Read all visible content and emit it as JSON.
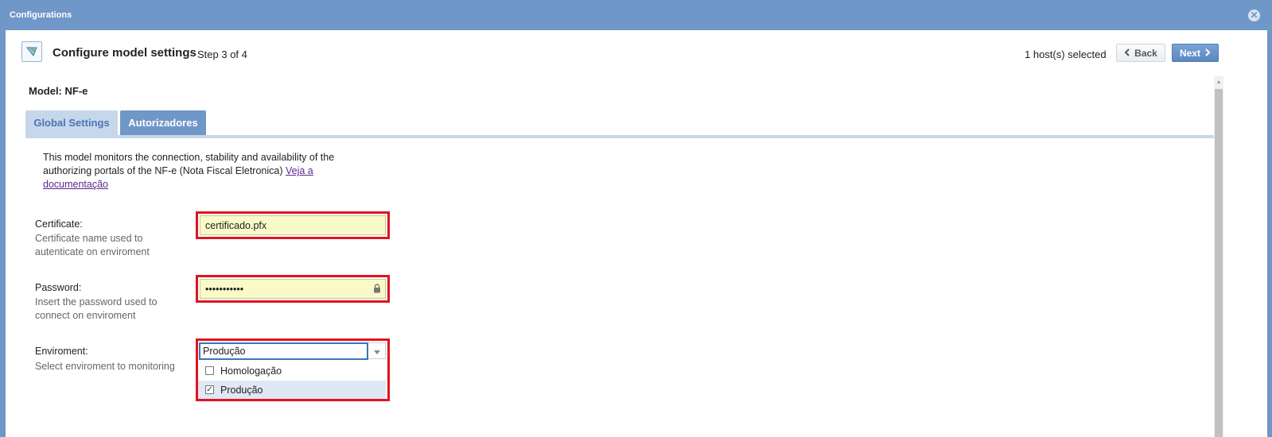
{
  "window": {
    "title": "Configurations"
  },
  "header": {
    "title": "Configure model settings",
    "step": "Step 3 of 4",
    "hosts_selected": "1 host(s) selected",
    "back_label": "Back",
    "next_label": "Next"
  },
  "model": {
    "label": "Model: NF-e"
  },
  "tabs": [
    {
      "label": "Global Settings"
    },
    {
      "label": "Autorizadores"
    }
  ],
  "description": {
    "text": "This model monitors the connection, stability and availability of the authorizing portals of the NF-e (Nota Fiscal Eletronica) ",
    "link": "Veja a documentação"
  },
  "fields": {
    "certificate": {
      "label": "Certificate:",
      "help": "Certificate name used to autenticate on enviroment",
      "value": "certificado.pfx"
    },
    "password": {
      "label": "Password:",
      "help": "Insert the password used to connect on enviroment",
      "value": "•••••••••••"
    },
    "environment": {
      "label": "Enviroment:",
      "help": "Select enviroment to monitoring",
      "value": "Produção",
      "options": [
        {
          "label": "Homologação",
          "checked": false
        },
        {
          "label": "Produção",
          "checked": true
        }
      ]
    }
  },
  "colors": {
    "window_blue": "#6f97c8",
    "highlight_red": "#e0141e",
    "input_yellow": "#fafac8"
  }
}
